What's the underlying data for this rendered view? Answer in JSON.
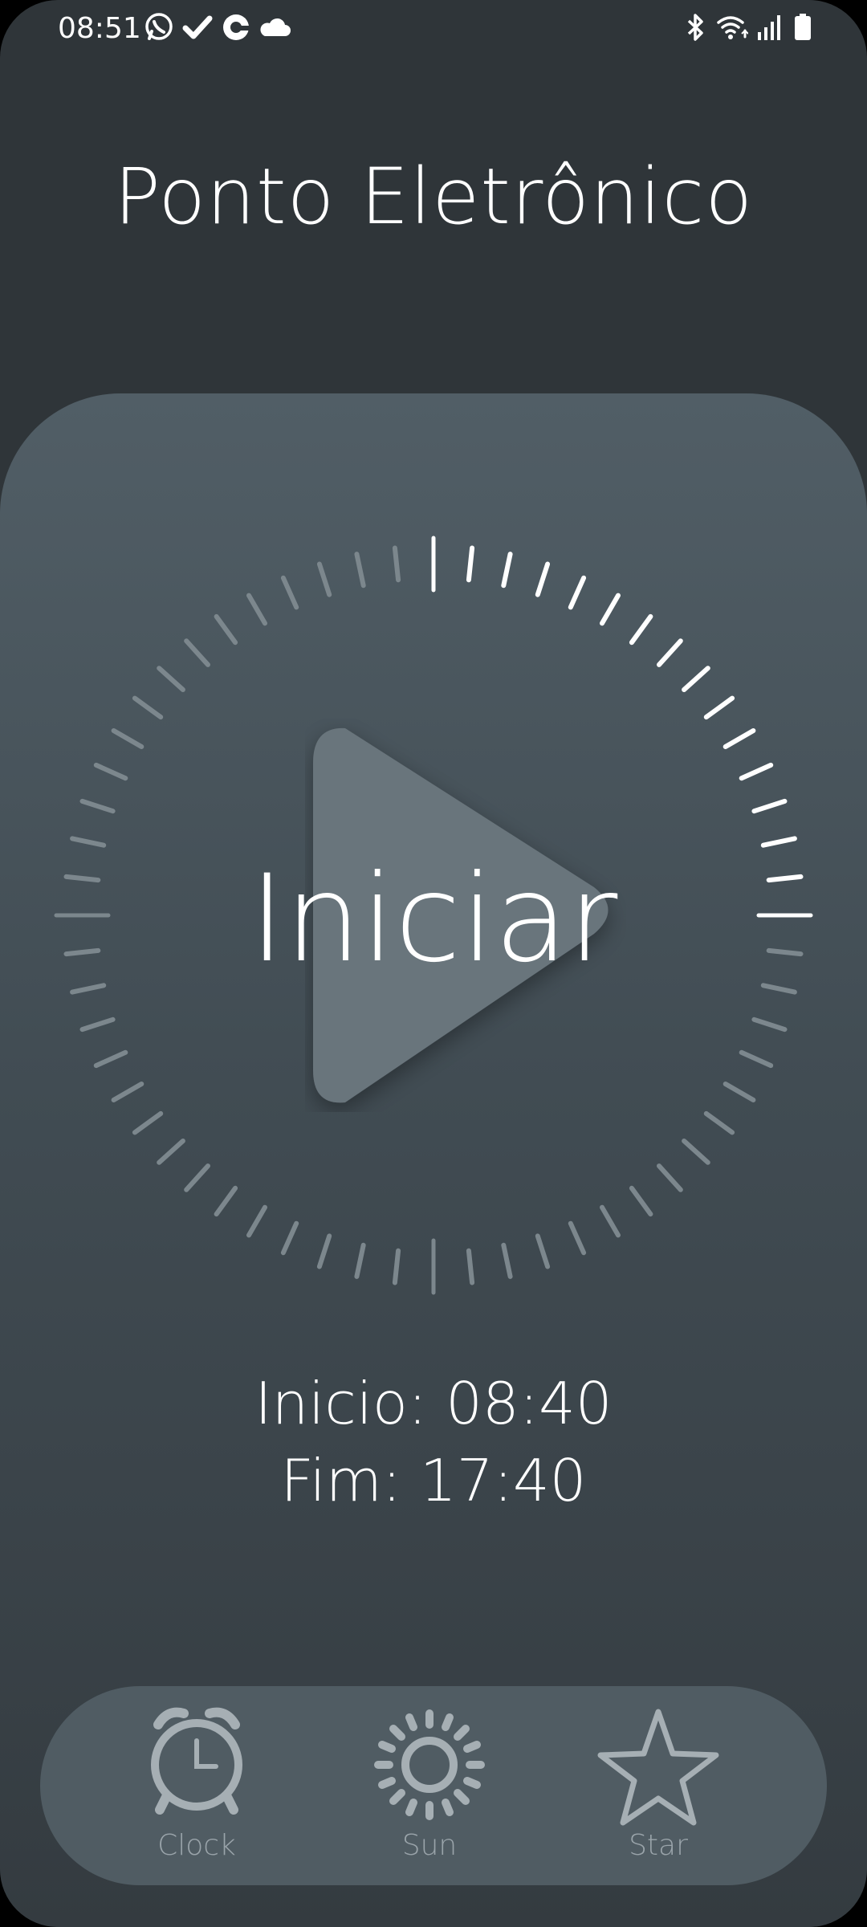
{
  "status_bar": {
    "time": "08:51",
    "left_icons": [
      "whatsapp-icon",
      "check-icon",
      "sync-app-icon",
      "cloud-icon"
    ],
    "right_icons": [
      "bluetooth-icon",
      "wifi-icon",
      "signal-icon",
      "battery-icon"
    ]
  },
  "header": {
    "title": "Ponto Eletrônico"
  },
  "timer": {
    "button_label": "Iniciar",
    "icon": "play-icon"
  },
  "schedule": {
    "start": "Inicio: 08:40",
    "end": "Fim: 17:40"
  },
  "bottom_nav": {
    "items": [
      {
        "label": "Clock",
        "icon": "alarm-clock-icon"
      },
      {
        "label": "Sun",
        "icon": "sun-icon"
      },
      {
        "label": "Star",
        "icon": "star-icon"
      }
    ]
  },
  "colors": {
    "background": "#2f3539",
    "card_top": "#515e66",
    "nav_background": "#505c63",
    "text": "#ffffff",
    "nav_icon": "#a6afb4"
  }
}
